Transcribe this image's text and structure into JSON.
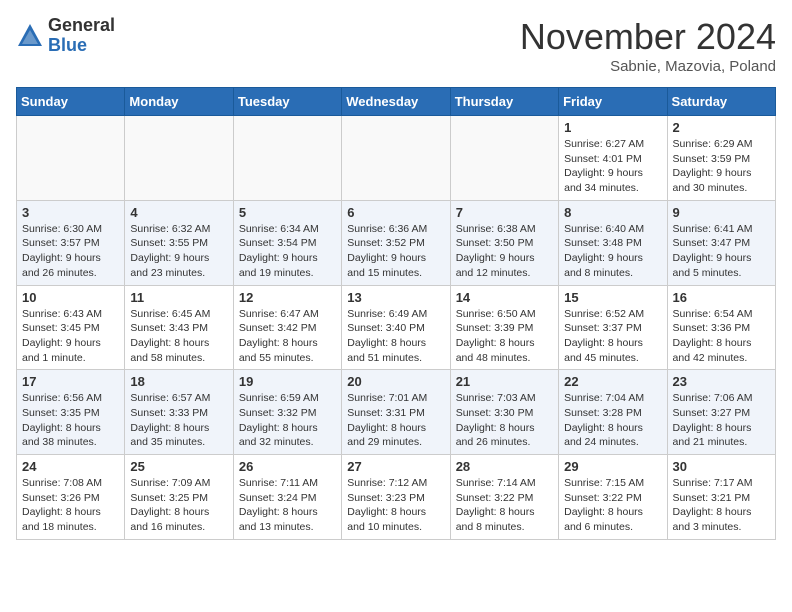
{
  "logo": {
    "general": "General",
    "blue": "Blue"
  },
  "title": "November 2024",
  "subtitle": "Sabnie, Mazovia, Poland",
  "days_of_week": [
    "Sunday",
    "Monday",
    "Tuesday",
    "Wednesday",
    "Thursday",
    "Friday",
    "Saturday"
  ],
  "weeks": [
    {
      "shaded": false,
      "days": [
        {
          "number": "",
          "info": ""
        },
        {
          "number": "",
          "info": ""
        },
        {
          "number": "",
          "info": ""
        },
        {
          "number": "",
          "info": ""
        },
        {
          "number": "",
          "info": ""
        },
        {
          "number": "1",
          "info": "Sunrise: 6:27 AM\nSunset: 4:01 PM\nDaylight: 9 hours and 34 minutes."
        },
        {
          "number": "2",
          "info": "Sunrise: 6:29 AM\nSunset: 3:59 PM\nDaylight: 9 hours and 30 minutes."
        }
      ]
    },
    {
      "shaded": true,
      "days": [
        {
          "number": "3",
          "info": "Sunrise: 6:30 AM\nSunset: 3:57 PM\nDaylight: 9 hours and 26 minutes."
        },
        {
          "number": "4",
          "info": "Sunrise: 6:32 AM\nSunset: 3:55 PM\nDaylight: 9 hours and 23 minutes."
        },
        {
          "number": "5",
          "info": "Sunrise: 6:34 AM\nSunset: 3:54 PM\nDaylight: 9 hours and 19 minutes."
        },
        {
          "number": "6",
          "info": "Sunrise: 6:36 AM\nSunset: 3:52 PM\nDaylight: 9 hours and 15 minutes."
        },
        {
          "number": "7",
          "info": "Sunrise: 6:38 AM\nSunset: 3:50 PM\nDaylight: 9 hours and 12 minutes."
        },
        {
          "number": "8",
          "info": "Sunrise: 6:40 AM\nSunset: 3:48 PM\nDaylight: 9 hours and 8 minutes."
        },
        {
          "number": "9",
          "info": "Sunrise: 6:41 AM\nSunset: 3:47 PM\nDaylight: 9 hours and 5 minutes."
        }
      ]
    },
    {
      "shaded": false,
      "days": [
        {
          "number": "10",
          "info": "Sunrise: 6:43 AM\nSunset: 3:45 PM\nDaylight: 9 hours and 1 minute."
        },
        {
          "number": "11",
          "info": "Sunrise: 6:45 AM\nSunset: 3:43 PM\nDaylight: 8 hours and 58 minutes."
        },
        {
          "number": "12",
          "info": "Sunrise: 6:47 AM\nSunset: 3:42 PM\nDaylight: 8 hours and 55 minutes."
        },
        {
          "number": "13",
          "info": "Sunrise: 6:49 AM\nSunset: 3:40 PM\nDaylight: 8 hours and 51 minutes."
        },
        {
          "number": "14",
          "info": "Sunrise: 6:50 AM\nSunset: 3:39 PM\nDaylight: 8 hours and 48 minutes."
        },
        {
          "number": "15",
          "info": "Sunrise: 6:52 AM\nSunset: 3:37 PM\nDaylight: 8 hours and 45 minutes."
        },
        {
          "number": "16",
          "info": "Sunrise: 6:54 AM\nSunset: 3:36 PM\nDaylight: 8 hours and 42 minutes."
        }
      ]
    },
    {
      "shaded": true,
      "days": [
        {
          "number": "17",
          "info": "Sunrise: 6:56 AM\nSunset: 3:35 PM\nDaylight: 8 hours and 38 minutes."
        },
        {
          "number": "18",
          "info": "Sunrise: 6:57 AM\nSunset: 3:33 PM\nDaylight: 8 hours and 35 minutes."
        },
        {
          "number": "19",
          "info": "Sunrise: 6:59 AM\nSunset: 3:32 PM\nDaylight: 8 hours and 32 minutes."
        },
        {
          "number": "20",
          "info": "Sunrise: 7:01 AM\nSunset: 3:31 PM\nDaylight: 8 hours and 29 minutes."
        },
        {
          "number": "21",
          "info": "Sunrise: 7:03 AM\nSunset: 3:30 PM\nDaylight: 8 hours and 26 minutes."
        },
        {
          "number": "22",
          "info": "Sunrise: 7:04 AM\nSunset: 3:28 PM\nDaylight: 8 hours and 24 minutes."
        },
        {
          "number": "23",
          "info": "Sunrise: 7:06 AM\nSunset: 3:27 PM\nDaylight: 8 hours and 21 minutes."
        }
      ]
    },
    {
      "shaded": false,
      "days": [
        {
          "number": "24",
          "info": "Sunrise: 7:08 AM\nSunset: 3:26 PM\nDaylight: 8 hours and 18 minutes."
        },
        {
          "number": "25",
          "info": "Sunrise: 7:09 AM\nSunset: 3:25 PM\nDaylight: 8 hours and 16 minutes."
        },
        {
          "number": "26",
          "info": "Sunrise: 7:11 AM\nSunset: 3:24 PM\nDaylight: 8 hours and 13 minutes."
        },
        {
          "number": "27",
          "info": "Sunrise: 7:12 AM\nSunset: 3:23 PM\nDaylight: 8 hours and 10 minutes."
        },
        {
          "number": "28",
          "info": "Sunrise: 7:14 AM\nSunset: 3:22 PM\nDaylight: 8 hours and 8 minutes."
        },
        {
          "number": "29",
          "info": "Sunrise: 7:15 AM\nSunset: 3:22 PM\nDaylight: 8 hours and 6 minutes."
        },
        {
          "number": "30",
          "info": "Sunrise: 7:17 AM\nSunset: 3:21 PM\nDaylight: 8 hours and 3 minutes."
        }
      ]
    }
  ]
}
